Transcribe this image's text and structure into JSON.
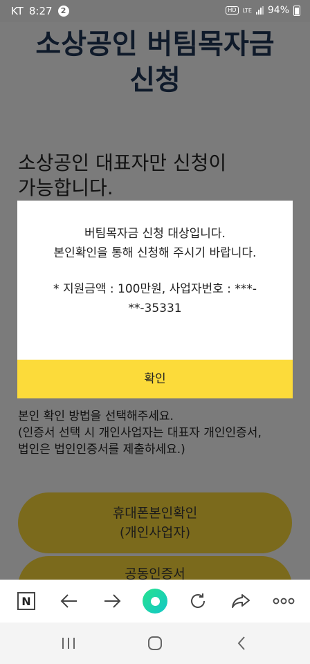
{
  "status_bar": {
    "carrier": "KT",
    "time": "8:27",
    "notification_count": "2",
    "hd": "HD",
    "lte": "LTE",
    "battery": "94%"
  },
  "page": {
    "title_line1": "소상공인 버팀목자금",
    "title_line2": "신청",
    "subtitle_line1": "소상공인 대표자만 신청이",
    "subtitle_line2": "가능합니다.",
    "method_line1": "본인 확인 방법을 선택해주세요.",
    "method_line2": "(인증서 선택 시 개인사업자는 대표자 개인인증서,",
    "method_line3": "법인은 법인인증서를 제출하세요.)",
    "phone_button_line1": "휴대폰본인확인",
    "phone_button_line2": "(개인사업자)",
    "cert_button_line1": "공동인증서"
  },
  "modal": {
    "line1": "버팀목자금 신청 대상입니다.",
    "line2": "본인확인을 통해 신청해 주시기 바랍니다.",
    "line3": "* 지원금액 : 100만원, 사업자번호 : ***-",
    "line4": "**-35331",
    "confirm_label": "확인"
  },
  "browser_bar": {
    "home_logo": "N",
    "icons": [
      "naver-home-icon",
      "back-arrow-icon",
      "forward-arrow-icon",
      "green-dot-icon",
      "refresh-icon",
      "share-icon",
      "more-icon"
    ]
  },
  "nav_bar": {
    "icons": [
      "recent-apps-icon",
      "home-icon",
      "back-icon"
    ]
  },
  "colors": {
    "overlay_bg": "#7b7b7b",
    "modal_confirm": "#fcdb3a",
    "button_dimmed": "#7b6a1c",
    "title_text": "#0f1a2a"
  }
}
